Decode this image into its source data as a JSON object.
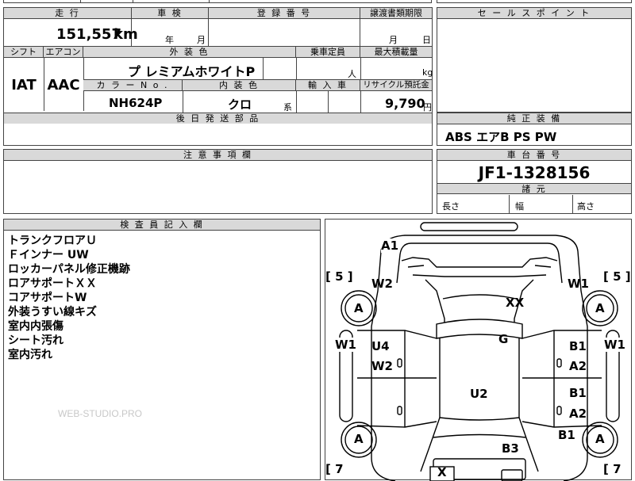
{
  "sheet": {
    "headers": {
      "mileage": "走 行",
      "inspection": "車 検",
      "registration": "登 録 番 号",
      "transfer_deadline": "譲渡書類期限",
      "sales_point": "セ ー ル ス ポ イ ン ト",
      "shift": "シフト",
      "aircon": "エアコン",
      "exterior_color": "外 装 色",
      "capacity": "乗車定員",
      "max_load": "最大積載量",
      "color_no": "カ ラ ー N o .",
      "interior_color": "内 装 色",
      "import": "輸 入 車",
      "recycle": "リサイクル預託金",
      "parts": "後 日 発 送 部 品",
      "equipment": "純 正 装 備",
      "notes": "注 意 事 項 欄",
      "chassis": "車 台 番 号",
      "dimensions": "諸 元",
      "inspector": "検 査 員 記 入 欄"
    },
    "mileage_value": "151,557",
    "mileage_unit": "km",
    "inspection_year_unit": "年",
    "inspection_month_unit": "月",
    "deadline_month_unit": "月",
    "deadline_day_unit": "日",
    "shift_value": "IAT",
    "aircon_value": "AAC",
    "exterior_color_value": "プ レミアムホワイトP",
    "capacity_unit": "人",
    "load_unit": "kg",
    "color_no_value": "NH624P",
    "interior_color_value": "クロ",
    "interior_color_suffix": "系",
    "recycle_value": "9,790",
    "recycle_unit": "円",
    "equipment_value": "ABS エアB PS PW",
    "chassis_value": "JF1-1328156",
    "dim_length": "長さ",
    "dim_width": "幅",
    "dim_height": "高さ",
    "inspector_notes": [
      "トランクフロアＵ",
      "Ｆインナー UW",
      "ロッカーパネル修正機跡",
      "ロアサポートＸＸ",
      "コアサポートW",
      "外装うすい線キズ",
      "室内内張傷",
      "シート汚れ",
      "室内汚れ"
    ],
    "watermark": "WEB-STUDIO.PRO"
  },
  "diagram": {
    "bracket_5_left": "[ 5 ]",
    "bracket_5_right": "[ 5 ]",
    "bracket_7_left": "[ 7",
    "bracket_7_right": "[ 7",
    "marks": {
      "a1": "A1",
      "w2_top": "W2",
      "w1_top": "W1",
      "xx": "XX",
      "a_front_left": "A",
      "a_front_right": "A",
      "w1_left": "W1",
      "w1_right": "W1",
      "u4": "U4",
      "g": "G",
      "b1_upper": "B1",
      "w2_side": "W2",
      "a2_upper": "A2",
      "u2": "U2",
      "b1_mid": "B1",
      "a2_lower": "A2",
      "b1_lower": "B1",
      "a_rear_left": "A",
      "a_rear_right": "A",
      "b3": "B3",
      "x_bottom": "X"
    }
  }
}
